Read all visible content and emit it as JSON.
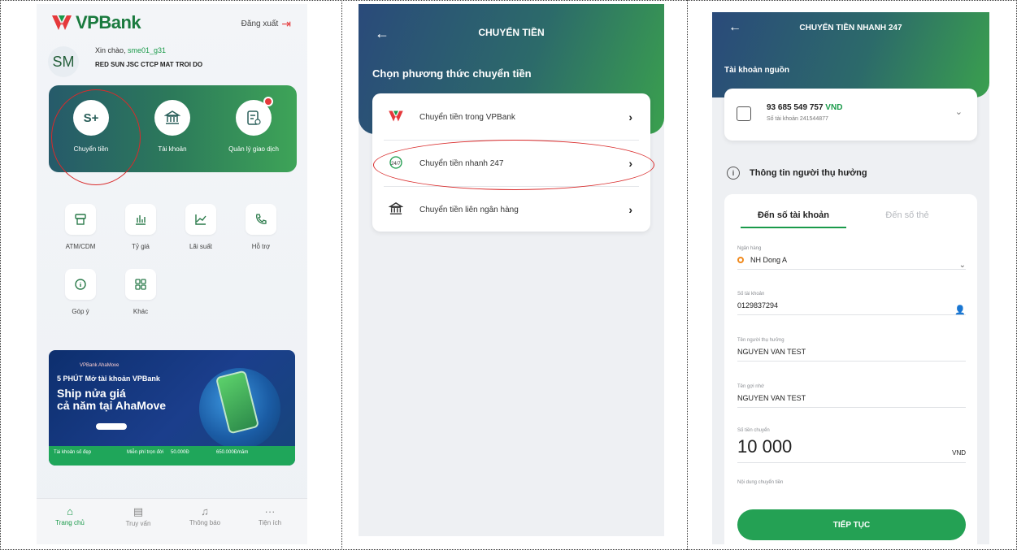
{
  "screen1": {
    "brand": "VPBank",
    "logout_label": "Đăng xuất",
    "avatar_initials": "SM",
    "greeting_prefix": "Xin chào, ",
    "username": "sme01_g31",
    "company": "RED SUN JSC CTCP MAT TROI DO",
    "quick_actions": [
      {
        "icon": "S+",
        "label": "Chuyển tiền"
      },
      {
        "icon": "bank-icon",
        "label": "Tài khoản"
      },
      {
        "icon": "receipt-icon",
        "label": "Quản lý giao dịch"
      }
    ],
    "services": [
      {
        "icon": "atm-icon",
        "label": "ATM/CDM"
      },
      {
        "icon": "chart-bar-icon",
        "label": "Tỷ giá"
      },
      {
        "icon": "chart-line-icon",
        "label": "Lãi suất"
      },
      {
        "icon": "phone-icon",
        "label": "Hỗ trợ"
      },
      {
        "icon": "info-icon",
        "label": "Góp ý"
      },
      {
        "icon": "grid-icon",
        "label": "Khác"
      }
    ],
    "banner": {
      "brands": "VPBank  AhaMove",
      "line1": "5 PHÚT Mở tài khoản VPBank",
      "line2": "Ship nửa giá",
      "line3": "cả năm tại AhaMove",
      "strip": [
        "Tài khoản số đẹp",
        "Miễn phí trọn đời",
        "50.000Đ",
        "650.000Đ/năm"
      ]
    },
    "tabs": [
      {
        "icon": "home-icon",
        "label": "Trang chủ",
        "active": true
      },
      {
        "icon": "search-doc-icon",
        "label": "Truy vấn",
        "active": false
      },
      {
        "icon": "bell-icon",
        "label": "Thông báo",
        "active": false
      },
      {
        "icon": "more-icon",
        "label": "Tiện ích",
        "active": false
      }
    ]
  },
  "screen2": {
    "title": "CHUYỂN TIỀN",
    "subtitle": "Chọn phương thức chuyển tiền",
    "options": [
      {
        "icon": "vpbank-logo-icon",
        "label": "Chuyển tiền trong VPBank"
      },
      {
        "icon": "247-icon",
        "label": "Chuyển tiền nhanh 247"
      },
      {
        "icon": "bank-icon",
        "label": "Chuyển tiền liên ngân hàng"
      }
    ]
  },
  "screen3": {
    "title": "CHUYỂN TIỀN NHANH 247",
    "source_label": "Tài khoản nguồn",
    "balance": "93 685 549 757",
    "currency": "VND",
    "account_number": "Số tài khoản 241544877",
    "beneficiary_label": "Thông tin người thụ hưởng",
    "tab_account": "Đến số tài khoản",
    "tab_card": "Đến số thẻ",
    "fields": {
      "bank_label": "Ngân hàng",
      "bank_value": "NH Dong A",
      "account_label": "Số tài khoản",
      "account_value": "0129837294",
      "name_label": "Tên người thụ hưởng",
      "name_value": "NGUYEN VAN TEST",
      "nickname_label": "Tên gợi nhớ",
      "nickname_value": "NGUYEN VAN TEST",
      "amount_label": "Số tiền chuyển",
      "amount_value": "10 000",
      "amount_currency": "VND",
      "content_label": "Nội dung chuyển tiền"
    },
    "continue_button": "TIẾP TỤC"
  },
  "colors": {
    "brand_green": "#1a9a4a",
    "header_gradient_start": "#2a4a7a",
    "header_gradient_end": "#3aa04e",
    "highlight_red": "#d92b2b"
  }
}
